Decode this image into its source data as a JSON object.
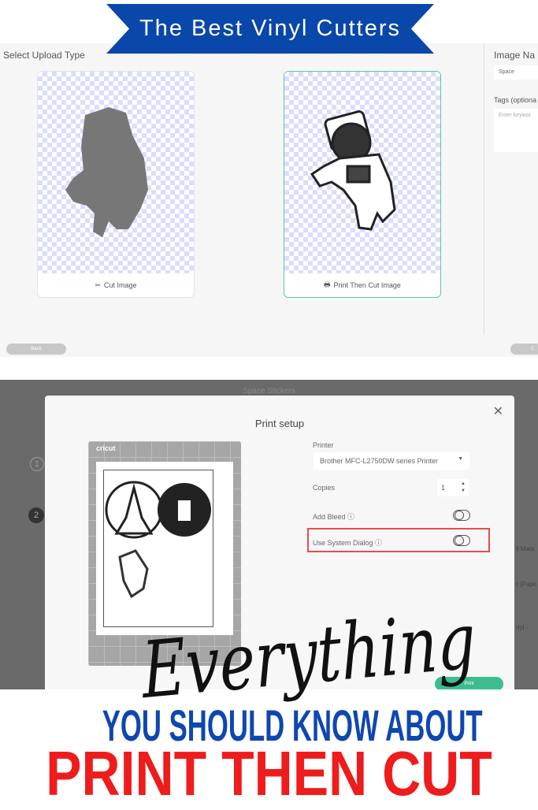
{
  "banner": {
    "title": "The Best Vinyl Cutters",
    "color": "#0a47aa"
  },
  "upload": {
    "heading": "Select Upload Type",
    "options": [
      {
        "label": "Cut Image",
        "icon": "scissors-icon"
      },
      {
        "label": "Print Then Cut Image",
        "icon": "printer-icon",
        "selected": true
      }
    ],
    "side": {
      "name_label": "Image Na",
      "name_value": "Space",
      "tags_label": "Tags (optiona",
      "tags_placeholder": "Enter keywor"
    },
    "back_label": "Back",
    "next_label": "C"
  },
  "print": {
    "window_title": "Space Stickers",
    "title": "Print setup",
    "mat_brand": "cricut",
    "printer_label": "Printer",
    "printer_value": "Brother MFC-L2750DW series Printer",
    "copies_label": "Copies",
    "copies_value": "1",
    "bleed_label": "Add Bleed",
    "system_dialog_label": "Use System Dialog",
    "print_button": "Print",
    "steps": [
      "1",
      "2"
    ],
    "side_fragments": [
      "ll Mate",
      "r (Pape",
      "nyl -"
    ],
    "accent": "#3dbd8f",
    "highlight": "#e84c4c"
  },
  "headline": {
    "script": "Everything",
    "line1": "YOU SHOULD KNOW ABOUT",
    "line2": "PRINT THEN CUT",
    "line1_color": "#0f47b0",
    "line2_color": "#ee1c1c"
  }
}
